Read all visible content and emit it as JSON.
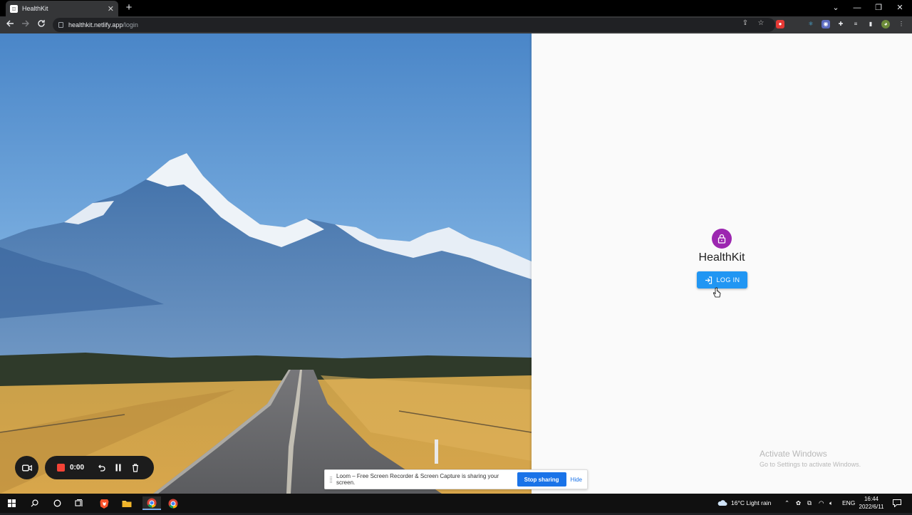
{
  "browser": {
    "tab_title": "HealthKit",
    "tab_close": "✕",
    "new_tab": "+",
    "url_host": "healthkit.netlify.app",
    "url_path": "/login",
    "window_controls": {
      "dropdown": "⌄",
      "minimize": "—",
      "restore": "❐",
      "close": "✕"
    }
  },
  "login": {
    "app_name": "HealthKit",
    "button_label": "LOG IN",
    "accent_color": "#9c27b0",
    "button_color": "#2196f3"
  },
  "windows_watermark": {
    "title": "Activate Windows",
    "subtitle": "Go to Settings to activate Windows."
  },
  "loom": {
    "timer": "0:00"
  },
  "share_notice": {
    "text": "Loom – Free Screen Recorder & Screen Capture is sharing your screen.",
    "stop_button": "Stop sharing",
    "hide_button": "Hide"
  },
  "taskbar": {
    "weather": "16°C  Light rain",
    "language": "ENG",
    "time": "16:44",
    "date": "2022/6/11"
  }
}
